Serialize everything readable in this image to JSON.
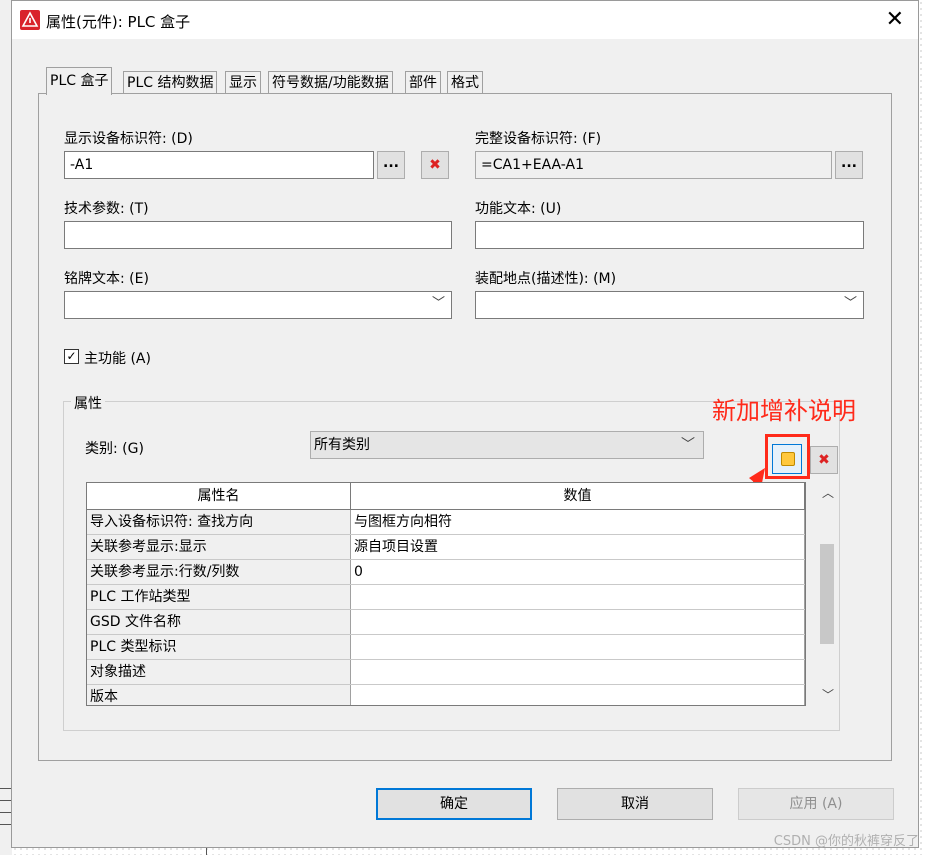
{
  "window": {
    "title": "属性(元件): PLC 盒子",
    "close_glyph": "✕"
  },
  "tabs": [
    {
      "label": "PLC 盒子",
      "active": true
    },
    {
      "label": "PLC 结构数据"
    },
    {
      "label": "显示"
    },
    {
      "label": "符号数据/功能数据"
    },
    {
      "label": "部件"
    },
    {
      "label": "格式"
    }
  ],
  "fields": {
    "display_id": {
      "label": "显示设备标识符: (D)",
      "value": "-A1",
      "browse": "..."
    },
    "full_id": {
      "label": "完整设备标识符: (F)",
      "value": "=CA1+EAA-A1",
      "browse": "..."
    },
    "tech_params": {
      "label": "技术参数: (T)",
      "value": ""
    },
    "function_text": {
      "label": "功能文本: (U)",
      "value": ""
    },
    "nameplate": {
      "label": "铭牌文本: (E)",
      "value": ""
    },
    "mount_location": {
      "label": "装配地点(描述性): (M)",
      "value": ""
    }
  },
  "main_function": {
    "label": "主功能 (A)",
    "checked": true
  },
  "properties": {
    "group_title": "属性",
    "category_label": "类别: (G)",
    "category_value": "所有类别",
    "col_name": "属性名",
    "col_value": "数值",
    "rows": [
      {
        "name": "导入设备标识符: 查找方向",
        "value": "与图框方向相符"
      },
      {
        "name": "关联参考显示:显示",
        "value": "源自项目设置"
      },
      {
        "name": "关联参考显示:行数/列数",
        "value": "0"
      },
      {
        "name": "PLC 工作站类型",
        "value": ""
      },
      {
        "name": "GSD 文件名称",
        "value": ""
      },
      {
        "name": "PLC 类型标识",
        "value": ""
      },
      {
        "name": "对象描述",
        "value": ""
      },
      {
        "name": "版本",
        "value": ""
      }
    ]
  },
  "annotation": {
    "text": "新加增补说明",
    "color": "#ff2a1a"
  },
  "buttons": {
    "ok": "确定",
    "cancel": "取消",
    "apply": "应用 (A)"
  },
  "watermark": "CSDN @你的秋裤穿反了",
  "colors": {
    "accent": "#0078d7",
    "delete": "#d22222",
    "annotation": "#ff2a1a"
  }
}
